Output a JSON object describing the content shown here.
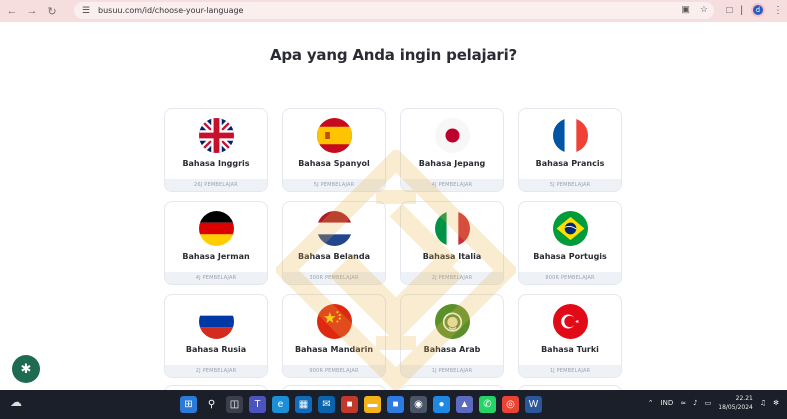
{
  "browser": {
    "url": "busuu.com/id/choose-your-language",
    "profile_initial": "d"
  },
  "page": {
    "title": "Apa yang Anda ingin pelajari?"
  },
  "languages": [
    {
      "name": "Bahasa Inggris",
      "learners": "26J PEMBELAJAR",
      "flag": "uk-flag"
    },
    {
      "name": "Bahasa Spanyol",
      "learners": "5J PEMBELAJAR",
      "flag": "spain-flag"
    },
    {
      "name": "Bahasa Jepang",
      "learners": "4J PEMBELAJAR",
      "flag": "japan-flag"
    },
    {
      "name": "Bahasa Prancis",
      "learners": "5J PEMBELAJAR",
      "flag": "france-flag"
    },
    {
      "name": "Bahasa Jerman",
      "learners": "4J PEMBELAJAR",
      "flag": "germany-flag"
    },
    {
      "name": "Bahasa Belanda",
      "learners": "300R PEMBELAJAR",
      "flag": "netherlands-flag"
    },
    {
      "name": "Bahasa Italia",
      "learners": "2J PEMBELAJAR",
      "flag": "italy-flag"
    },
    {
      "name": "Bahasa Portugis",
      "learners": "800R PEMBELAJAR",
      "flag": "brazil-flag"
    },
    {
      "name": "Bahasa Rusia",
      "learners": "2J PEMBELAJAR",
      "flag": "russia-flag"
    },
    {
      "name": "Bahasa Mandarin",
      "learners": "900R PEMBELAJAR",
      "flag": "china-flag"
    },
    {
      "name": "Bahasa Arab",
      "learners": "1J PEMBELAJAR",
      "flag": "arab-flag"
    },
    {
      "name": "Bahasa Turki",
      "learners": "1J PEMBELAJAR",
      "flag": "turkey-flag"
    }
  ],
  "taskbar": {
    "language": "IND",
    "time": "22.21",
    "date": "18/05/2024"
  },
  "colors": {
    "browser_bar": "#f6dede",
    "title_text": "#2b2c33",
    "card_border": "#e4e7ee",
    "card_footer": "#eef1f6",
    "cookie_button": "#1f6b52",
    "taskbar": "#1b1f2a"
  }
}
